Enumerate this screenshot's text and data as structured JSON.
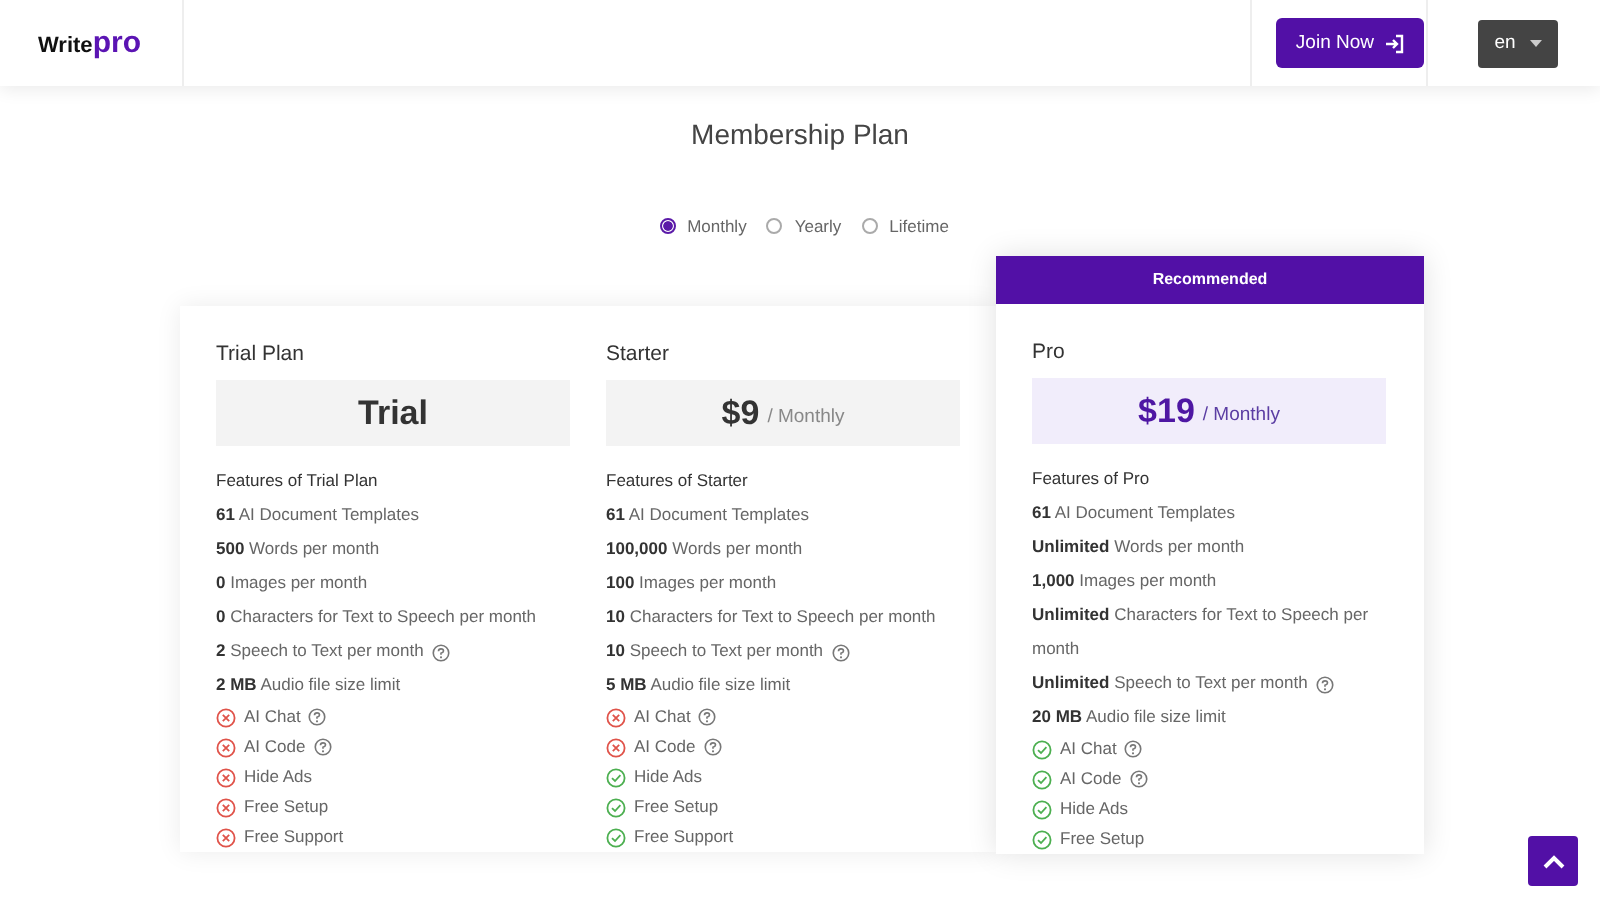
{
  "header": {
    "logo": {
      "text": "Write",
      "accent": "pro"
    },
    "join_button": "Join Now",
    "language": "en"
  },
  "title": "Membership Plan",
  "billing_options": [
    {
      "label": "Monthly",
      "selected": true
    },
    {
      "label": "Yearly",
      "selected": false
    },
    {
      "label": "Lifetime",
      "selected": false
    }
  ],
  "plans": [
    {
      "name": "Trial Plan",
      "recommended": false,
      "price": "Trial",
      "features_title": "Features of Trial Plan",
      "features": [
        {
          "kind": "quota",
          "text": "**61** AI Document Templates",
          "help": false
        },
        {
          "kind": "quota",
          "text": "**500** Words per month",
          "help": false
        },
        {
          "kind": "quota",
          "text": "**0** Images per month",
          "help": false
        },
        {
          "kind": "quota",
          "text": "**0** Characters for Text to Speech per month",
          "help": false
        },
        {
          "kind": "quota",
          "text": "**2** Speech to Text per month",
          "help": true
        },
        {
          "kind": "quota",
          "text": "**2 MB** Audio file size limit",
          "help": false
        },
        {
          "kind": "check",
          "text": "AI Chat",
          "included": false,
          "help": true
        },
        {
          "kind": "check",
          "text": "AI Code",
          "included": false,
          "help": true
        },
        {
          "kind": "check",
          "text": "Hide Ads",
          "included": false,
          "help": false
        },
        {
          "kind": "check",
          "text": "Free Setup",
          "included": false,
          "help": false
        },
        {
          "kind": "check",
          "text": "Free Support",
          "included": false,
          "help": false
        }
      ]
    },
    {
      "name": "Starter",
      "recommended": false,
      "price": "$9",
      "period": "/ Monthly",
      "features_title": "Features of Starter",
      "features": [
        {
          "kind": "quota",
          "text": "**61** AI Document Templates",
          "help": false
        },
        {
          "kind": "quota",
          "text": "**100,000** Words per month",
          "help": false
        },
        {
          "kind": "quota",
          "text": "**100** Images per month",
          "help": false
        },
        {
          "kind": "quota",
          "text": "**10** Characters for Text to Speech per month",
          "help": false
        },
        {
          "kind": "quota",
          "text": "**10** Speech to Text per month",
          "help": true
        },
        {
          "kind": "quota",
          "text": "**5 MB** Audio file size limit",
          "help": false
        },
        {
          "kind": "check",
          "text": "AI Chat",
          "included": false,
          "help": true
        },
        {
          "kind": "check",
          "text": "AI Code",
          "included": false,
          "help": true
        },
        {
          "kind": "check",
          "text": "Hide Ads",
          "included": true,
          "help": false
        },
        {
          "kind": "check",
          "text": "Free Setup",
          "included": true,
          "help": false
        },
        {
          "kind": "check",
          "text": "Free Support",
          "included": true,
          "help": false
        }
      ]
    },
    {
      "name": "Pro",
      "recommended": true,
      "badge": "Recommended",
      "price": "$19",
      "period": "/ Monthly",
      "features_title": "Features of Pro",
      "features": [
        {
          "kind": "quota",
          "text": "**61** AI Document Templates",
          "help": false
        },
        {
          "kind": "quota",
          "text": "**Unlimited** Words per month",
          "help": false
        },
        {
          "kind": "quota",
          "text": "**1,000** Images per month",
          "help": false
        },
        {
          "kind": "quota",
          "text": "**Unlimited** Characters for Text to Speech per month",
          "help": false
        },
        {
          "kind": "quota",
          "text": "**Unlimited** Speech to Text per month",
          "help": true
        },
        {
          "kind": "quota",
          "text": "**20 MB** Audio file size limit",
          "help": false
        },
        {
          "kind": "check",
          "text": "AI Chat",
          "included": true,
          "help": true
        },
        {
          "kind": "check",
          "text": "AI Code",
          "included": true,
          "help": true
        },
        {
          "kind": "check",
          "text": "Hide Ads",
          "included": true,
          "help": false
        },
        {
          "kind": "check",
          "text": "Free Setup",
          "included": true,
          "help": false
        }
      ]
    }
  ]
}
